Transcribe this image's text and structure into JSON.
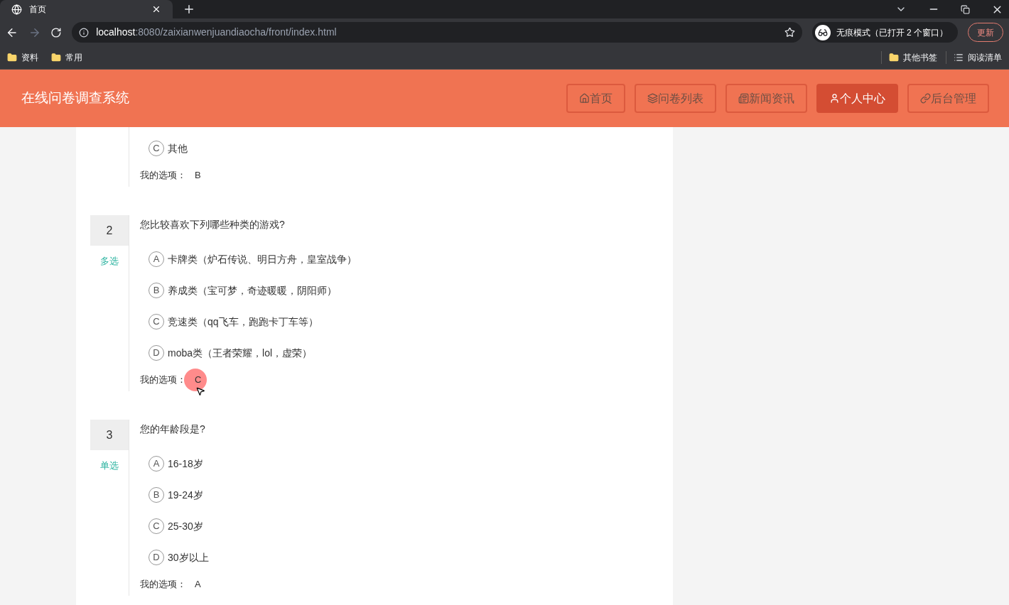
{
  "browser": {
    "tab_title": "首页",
    "url_host": "localhost",
    "url_path": ":8080/zaixianwenjuandiaocha/front/index.html",
    "profile_label": "无痕模式（已打开 2 个窗口）",
    "update_button": "更新",
    "bookmarks": [
      {
        "label": "资料",
        "kind": "folder"
      },
      {
        "label": "常用",
        "kind": "folder"
      }
    ],
    "bookmarks_right": [
      {
        "label": "其他书签",
        "kind": "folder"
      },
      {
        "label": "阅读清单",
        "kind": "list"
      }
    ]
  },
  "site": {
    "title": "在线问卷调查系统",
    "nav": [
      {
        "label": "首页",
        "selected": false
      },
      {
        "label": "问卷列表",
        "selected": false
      },
      {
        "label": "新闻资讯",
        "selected": false
      },
      {
        "label": "个人中心",
        "selected": true
      },
      {
        "label": "后台管理",
        "selected": false
      }
    ]
  },
  "questions": [
    {
      "options": [
        {
          "letter": "C",
          "text": "其他"
        }
      ],
      "answer_label": "我的选项：",
      "answer": "B"
    },
    {
      "number": "2",
      "type": "多选",
      "text": "您比较喜欢下列哪些种类的游戏?",
      "options": [
        {
          "letter": "A",
          "text": "卡牌类（炉石传说、明日方舟，皇室战争）"
        },
        {
          "letter": "B",
          "text": "养成类（宝可梦，奇迹暖暖，阴阳师）"
        },
        {
          "letter": "C",
          "text": "竞速类（qq飞车，跑跑卡丁车等）"
        },
        {
          "letter": "D",
          "text": "moba类（王者荣耀，lol，虚荣）"
        }
      ],
      "answer_label": "我的选项：",
      "answer": "C",
      "click_marker": true
    },
    {
      "number": "3",
      "type": "单选",
      "text": "您的年龄段是?",
      "options": [
        {
          "letter": "A",
          "text": "16-18岁"
        },
        {
          "letter": "B",
          "text": "19-24岁"
        },
        {
          "letter": "C",
          "text": "25-30岁"
        },
        {
          "letter": "D",
          "text": "30岁以上"
        }
      ],
      "answer_label": "我的选项：",
      "answer": "A"
    }
  ]
}
